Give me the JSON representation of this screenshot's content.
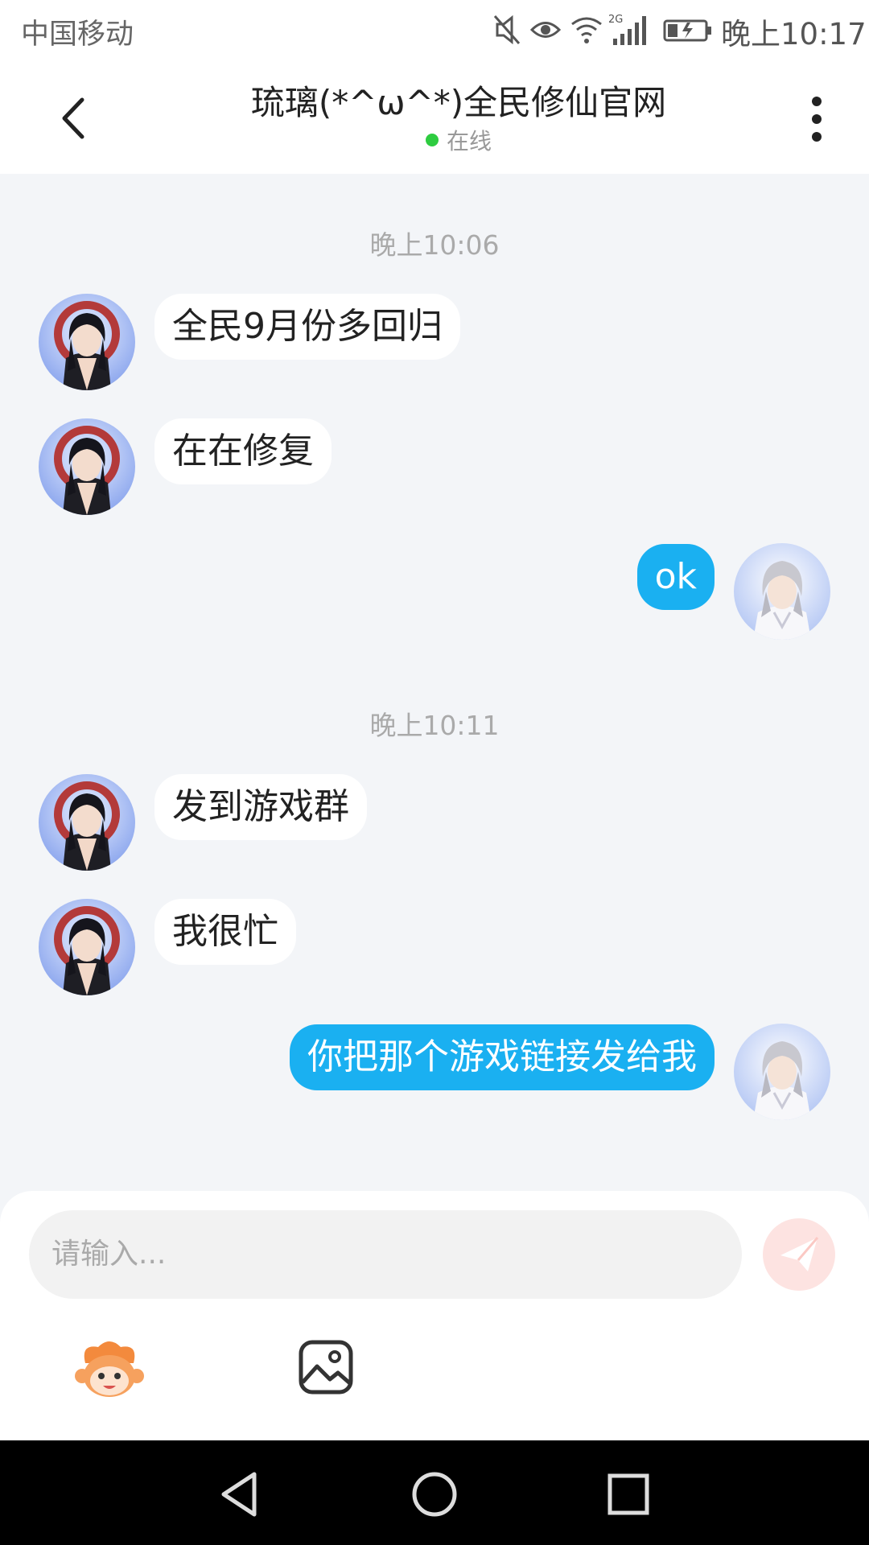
{
  "status_bar": {
    "carrier": "中国移动",
    "network": "2G",
    "time": "晚上10:17"
  },
  "header": {
    "title": "琉璃(*^ω^*)全民修仙官网",
    "status": "在线",
    "status_color": "#2ecc40"
  },
  "chat": {
    "groups": [
      {
        "timestamp": "晚上10:06",
        "messages": [
          {
            "from": "other",
            "text": "全民9月份多回归"
          },
          {
            "from": "other",
            "text": "在在修复"
          },
          {
            "from": "me",
            "text": "ok"
          }
        ]
      },
      {
        "timestamp": "晚上10:11",
        "messages": [
          {
            "from": "other",
            "text": "发到游戏群"
          },
          {
            "from": "other",
            "text": "我很忙"
          },
          {
            "from": "me",
            "text": "你把那个游戏链接发给我"
          }
        ]
      }
    ]
  },
  "composer": {
    "placeholder": "请输入...",
    "send_icon": "paper-plane-icon",
    "emoji_icon": "monkey-emoji-icon",
    "image_icon": "image-icon"
  },
  "colors": {
    "outgoing_bubble": "#1ab0f1",
    "incoming_bubble": "#ffffff",
    "chat_background": "#f3f5f8"
  },
  "nav_bar": {
    "back_icon": "triangle-back-icon",
    "home_icon": "circle-home-icon",
    "recents_icon": "square-recents-icon"
  }
}
